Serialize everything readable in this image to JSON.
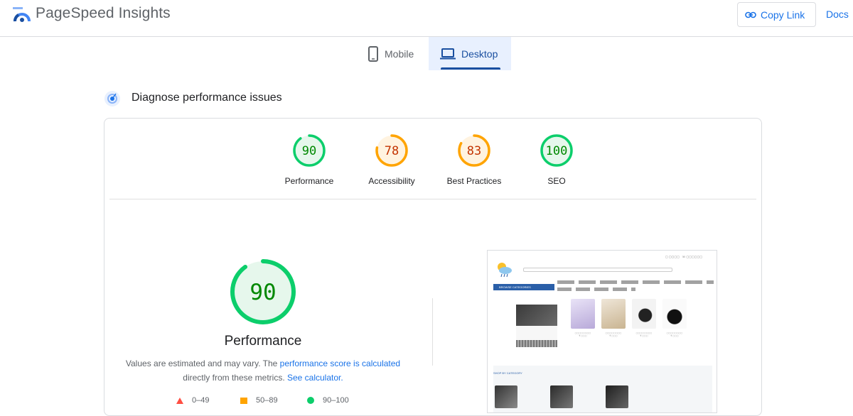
{
  "header": {
    "app_title": "PageSpeed Insights",
    "copy_link": "Copy Link",
    "docs": "Docs"
  },
  "tabs": [
    {
      "label": "Mobile",
      "icon": "phone-icon",
      "selected": false
    },
    {
      "label": "Desktop",
      "icon": "laptop-icon",
      "selected": true
    }
  ],
  "diagnose": {
    "title": "Diagnose performance issues",
    "icon": "diagnose-icon"
  },
  "scores": [
    {
      "label": "Performance",
      "value": "90",
      "score": 90,
      "color": "#0cce6b",
      "text_color": "#008800",
      "fill": "#e6f7ec"
    },
    {
      "label": "Accessibility",
      "value": "78",
      "score": 78,
      "color": "#ffa400",
      "text_color": "#c33300",
      "fill": "#fff3e0"
    },
    {
      "label": "Best Practices",
      "value": "83",
      "score": 83,
      "color": "#ffa400",
      "text_color": "#c33300",
      "fill": "#fff3e0"
    },
    {
      "label": "SEO",
      "value": "100",
      "score": 100,
      "color": "#0cce6b",
      "text_color": "#008800",
      "fill": "#e6f7ec"
    }
  ],
  "performance": {
    "value": "90",
    "score": 90,
    "label": "Performance",
    "note_prefix": "Values are estimated and may vary. The ",
    "note_link1": "performance score is calculated",
    "note_middle": "directly from these metrics. ",
    "note_link2": "See calculator."
  },
  "legend": [
    {
      "range": "0–49",
      "shape": "triangle",
      "color": "#ff4e42"
    },
    {
      "range": "50–89",
      "shape": "square",
      "color": "#ffa400"
    },
    {
      "range": "90–100",
      "shape": "circle",
      "color": "#0cce6b"
    }
  ],
  "thumbnail": {
    "browse_label": "BROWSE CATEGORIES",
    "section_title": "SHOP BY CATEGORY"
  }
}
